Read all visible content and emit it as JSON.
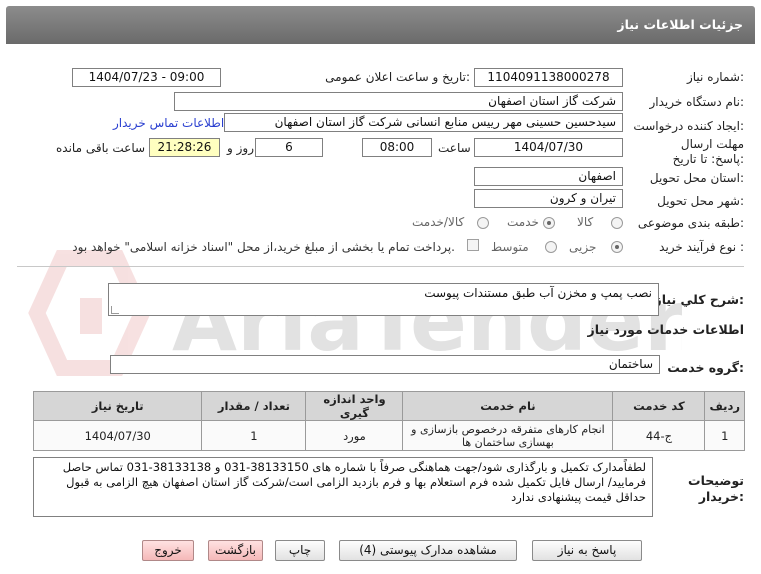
{
  "header": {
    "title": "جزئیات اطلاعات نیاز"
  },
  "need_number": {
    "label": "شماره نیاز:",
    "value": "1104091138000278"
  },
  "announce_datetime": {
    "label": "تاریخ و ساعت اعلان عمومی:",
    "value": "1404/07/23 - 09:00"
  },
  "buyer_org": {
    "label": "نام دستگاه خریدار:",
    "value": "شرکت گاز استان اصفهان"
  },
  "requester": {
    "label": "ایجاد کننده درخواست:",
    "value": "سیدحسین حسینی مهر رییس منابع انسانی شرکت گاز استان اصفهان",
    "contact_link": "اطلاعات تماس خریدار"
  },
  "deadline": {
    "label": "مهلت ارسال پاسخ: تا تاریخ:",
    "date": "1404/07/30",
    "time_label": "ساعت",
    "time": "08:00",
    "days": "6",
    "days_label": "روز و",
    "remaining": "21:28:26",
    "remaining_label": "ساعت باقی مانده"
  },
  "delivery_province": {
    "label": "استان محل تحویل:",
    "value": "اصفهان"
  },
  "delivery_city": {
    "label": "شهر محل تحویل:",
    "value": "تیران و کرون"
  },
  "category": {
    "label": "طبقه بندی موضوعی:",
    "options": [
      "کالا",
      "خدمت",
      "کالا/خدمت"
    ],
    "selected": "خدمت"
  },
  "process_type": {
    "label": "نوع فرآیند خرید :",
    "options": [
      "جزیی",
      "متوسط"
    ],
    "selected": "جزیی",
    "payment_note": "پرداخت تمام یا بخشی از مبلغ خرید،از محل \"اسناد خزانه اسلامی\" خواهد بود."
  },
  "general_desc": {
    "label": "شرح کلي نياز:",
    "value": "نصب پمپ و مخزن آب طبق مستندات پیوست"
  },
  "services_info": {
    "label": "اطلاعات خدمات مورد نیاز"
  },
  "service_group": {
    "label": "گروه خدمت:",
    "value": "ساختمان"
  },
  "table": {
    "headers": [
      "ردیف",
      "کد خدمت",
      "نام خدمت",
      "واحد اندازه گیری",
      "تعداد / مقدار",
      "تاریخ نیاز"
    ],
    "rows": [
      [
        "1",
        "ج-44",
        "انجام کارهای متفرقه درخصوص بازسازی و بهسازی ساختمان ها",
        "مورد",
        "1",
        "1404/07/30"
      ]
    ]
  },
  "buyer_notes": {
    "label": "توضیحات خریدار:",
    "value": "لطفاًمدارک تکمیل و بارگذاری شود/جهت هماهنگی صرفاً با شماره های  38133150-031 و 38133138-031 تماس حاصل فرمایید/ ارسال فایل تکمیل شده فرم استعلام بها و فرم بازدید الزامی است/شرکت گاز  استان اصفهان هیچ الزامی به قبول حداقل قیمت پیشنهادی ندارد"
  },
  "buttons": {
    "reply": "پاسخ به نیاز",
    "view_docs": "مشاهده مدارک پیوستی (4)",
    "print": "چاپ",
    "back": "بازگشت",
    "exit": "خروج"
  },
  "watermark": {
    "text": "AriaTender.neT"
  }
}
